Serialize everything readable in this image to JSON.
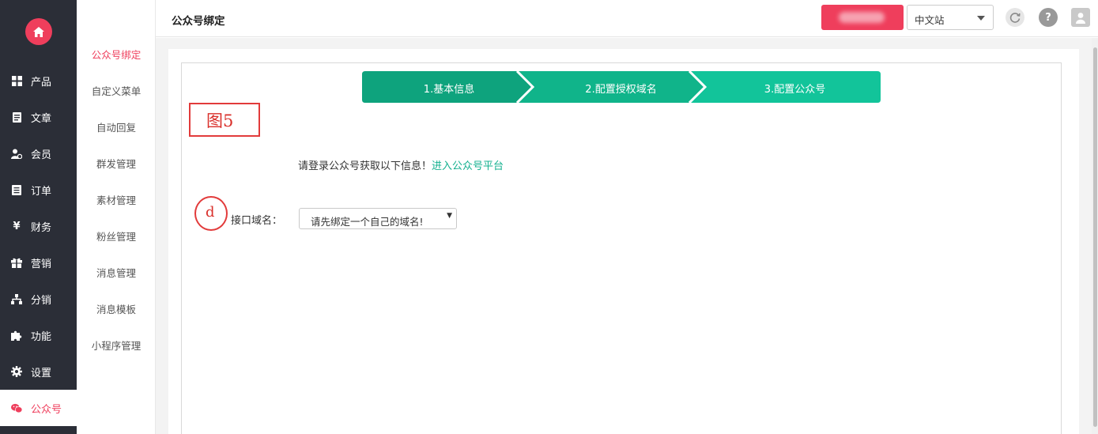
{
  "sidebar": {
    "logo_icon": "home-icon",
    "items": [
      {
        "label": "产品",
        "icon": "grid-icon"
      },
      {
        "label": "文章",
        "icon": "document-icon"
      },
      {
        "label": "会员",
        "icon": "member-icon"
      },
      {
        "label": "订单",
        "icon": "order-icon"
      },
      {
        "label": "财务",
        "icon": "yen-icon"
      },
      {
        "label": "营销",
        "icon": "gift-icon"
      },
      {
        "label": "分销",
        "icon": "sitemap-icon"
      },
      {
        "label": "功能",
        "icon": "puzzle-icon"
      },
      {
        "label": "设置",
        "icon": "gear-icon"
      },
      {
        "label": "公众号",
        "icon": "wechat-icon",
        "active": true
      }
    ]
  },
  "submenu": {
    "items": [
      {
        "label": "公众号绑定",
        "active": true
      },
      {
        "label": "自定义菜单"
      },
      {
        "label": "自动回复"
      },
      {
        "label": "群发管理"
      },
      {
        "label": "素材管理"
      },
      {
        "label": "粉丝管理"
      },
      {
        "label": "消息管理"
      },
      {
        "label": "消息模板"
      },
      {
        "label": "小程序管理"
      }
    ]
  },
  "header": {
    "title": "公众号绑定",
    "lang_select": {
      "value": "中文站"
    },
    "icons": [
      "refresh-icon",
      "help-icon",
      "user-icon"
    ]
  },
  "steps": [
    "1.基本信息",
    "2.配置授权域名",
    "3.配置公众号"
  ],
  "annotation_box": "图5",
  "annotation_circle": "d",
  "info": {
    "text": "请登录公众号获取以下信息！",
    "link": "进入公众号平台"
  },
  "form": {
    "domain_label": "接口域名：",
    "domain_select_value": "请先绑定一个自己的域名!"
  },
  "colors": {
    "sidebar_bg": "#2b2e37",
    "accent": "#ef3e5c",
    "step_green_1": "#0ea37d",
    "step_green_2": "#10b48a",
    "step_green_3": "#12c49a",
    "link_green": "#14b08f",
    "annotation_red": "#e23b3b"
  }
}
